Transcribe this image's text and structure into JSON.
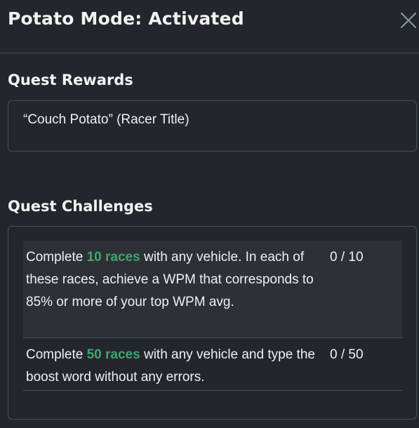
{
  "modal": {
    "title": "Potato Mode: Activated",
    "close_icon": "close-icon"
  },
  "rewards": {
    "heading": "Quest Rewards",
    "items": [
      "“Couch Potato” (Racer Title)"
    ]
  },
  "challenges": {
    "heading": "Quest Challenges",
    "highlight_color": "#3fa66b",
    "items": [
      {
        "before": "Complete ",
        "highlight": "10 races",
        "after": " with any vehicle. In each of these races, achieve a WPM that corresponds to 85% or more of your top WPM avg.",
        "progress": "0 / 10"
      },
      {
        "before": "Complete ",
        "highlight": "50 races",
        "after": " with any vehicle and type the boost word without any errors.",
        "progress": "0 / 50"
      }
    ]
  }
}
